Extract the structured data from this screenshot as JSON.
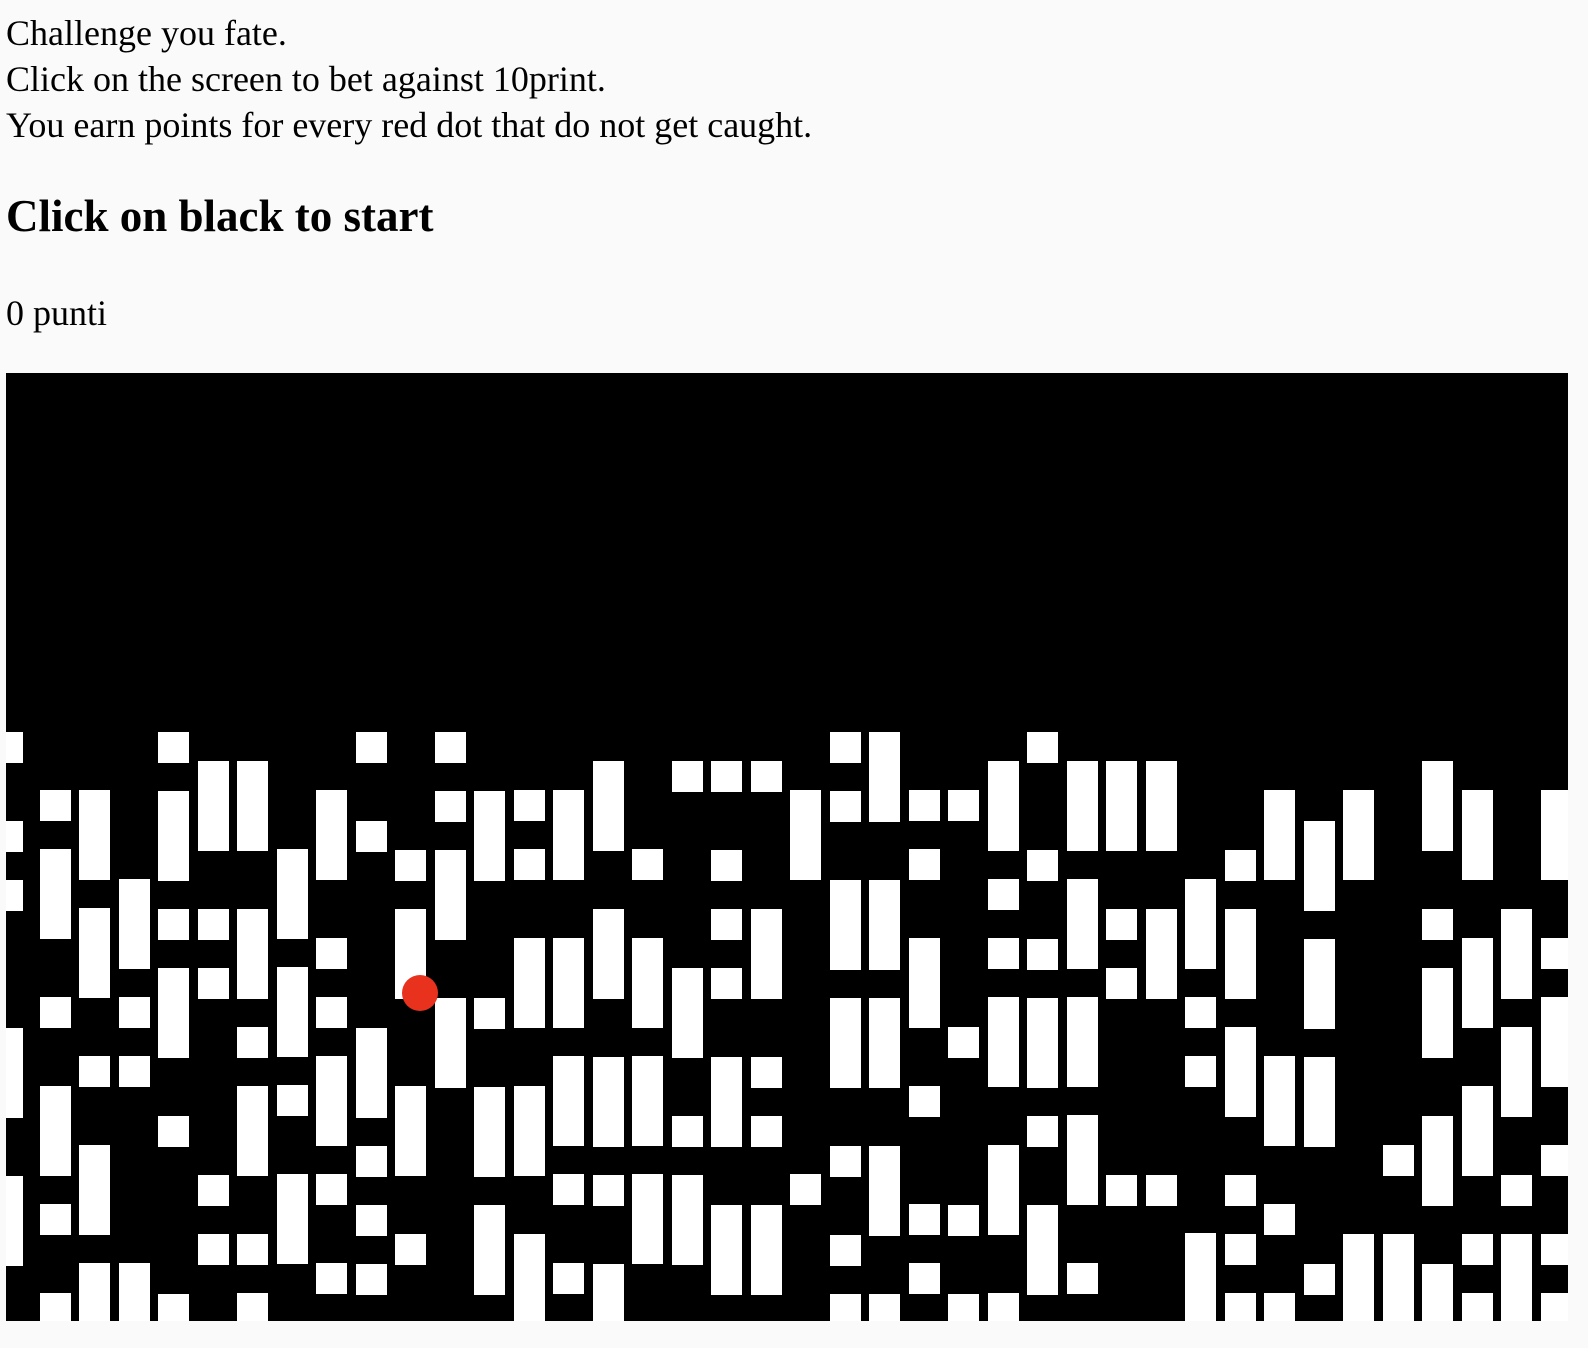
{
  "intro": {
    "line1": "Challenge you fate.",
    "line2": "Click on the screen to bet against 10print.",
    "line3": "You earn points for every red dot that do not get caught."
  },
  "heading": "Click on black to start",
  "score": {
    "label": "0 punti"
  },
  "game": {
    "background_color": "#000000",
    "tile_color": "#ffffff",
    "dot_color": "#e8321e"
  }
}
